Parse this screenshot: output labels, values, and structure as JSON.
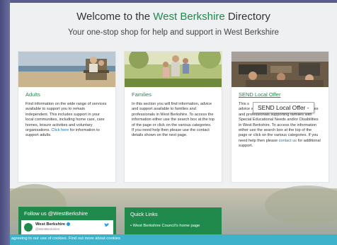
{
  "header": {
    "title_prefix": "Welcome to the ",
    "title_brand": "West Berkshire",
    "title_suffix": " Directory",
    "subtitle": "Your one-stop shop for help and support in West Berkshire"
  },
  "cards": [
    {
      "heading": "Adults",
      "text": "Find information on the wide range of services available to support you to remain independent. This includes support in your local communities, including home care, care homes, leisure activities and voluntary organisations.",
      "link": "Click here",
      "text_after": " for information to support adults."
    },
    {
      "heading": "Families",
      "text": "In this section you will find information, advice and support available to families and professionals in West Berkshire. To access the information either use the search box at the top of the page or click on the various categories. If you need help then please use the contact details shown on the next page."
    },
    {
      "heading": "SEND Local Offer",
      "text_visible_start": "This s",
      "text": "advice and support for young people, families and professionals supporting families with Special Educational Needs and/or Disabilities in West Berkshire. To access the information either use the search box at the top of the page or click on the various categories. If you need help then please ",
      "link": "contact us",
      "text_after": " for additional support."
    }
  ],
  "tooltip": "SEND Local Offer -",
  "twitter": {
    "title": "Follow us @WestBerkshire",
    "account_name": "West Berkshire",
    "handle": "@WestBerkshire"
  },
  "quick_links": {
    "title": "Quick Links",
    "items": [
      "West Berkshire Council's home page"
    ]
  },
  "cookie": {
    "text": "agreeing to our use of cookies. ",
    "link": "Find out more about cookies"
  },
  "colors": {
    "brand_green": "#1f8a4c",
    "cookie_bar": "#3eb2c9",
    "link_blue": "#1f6fb0"
  }
}
